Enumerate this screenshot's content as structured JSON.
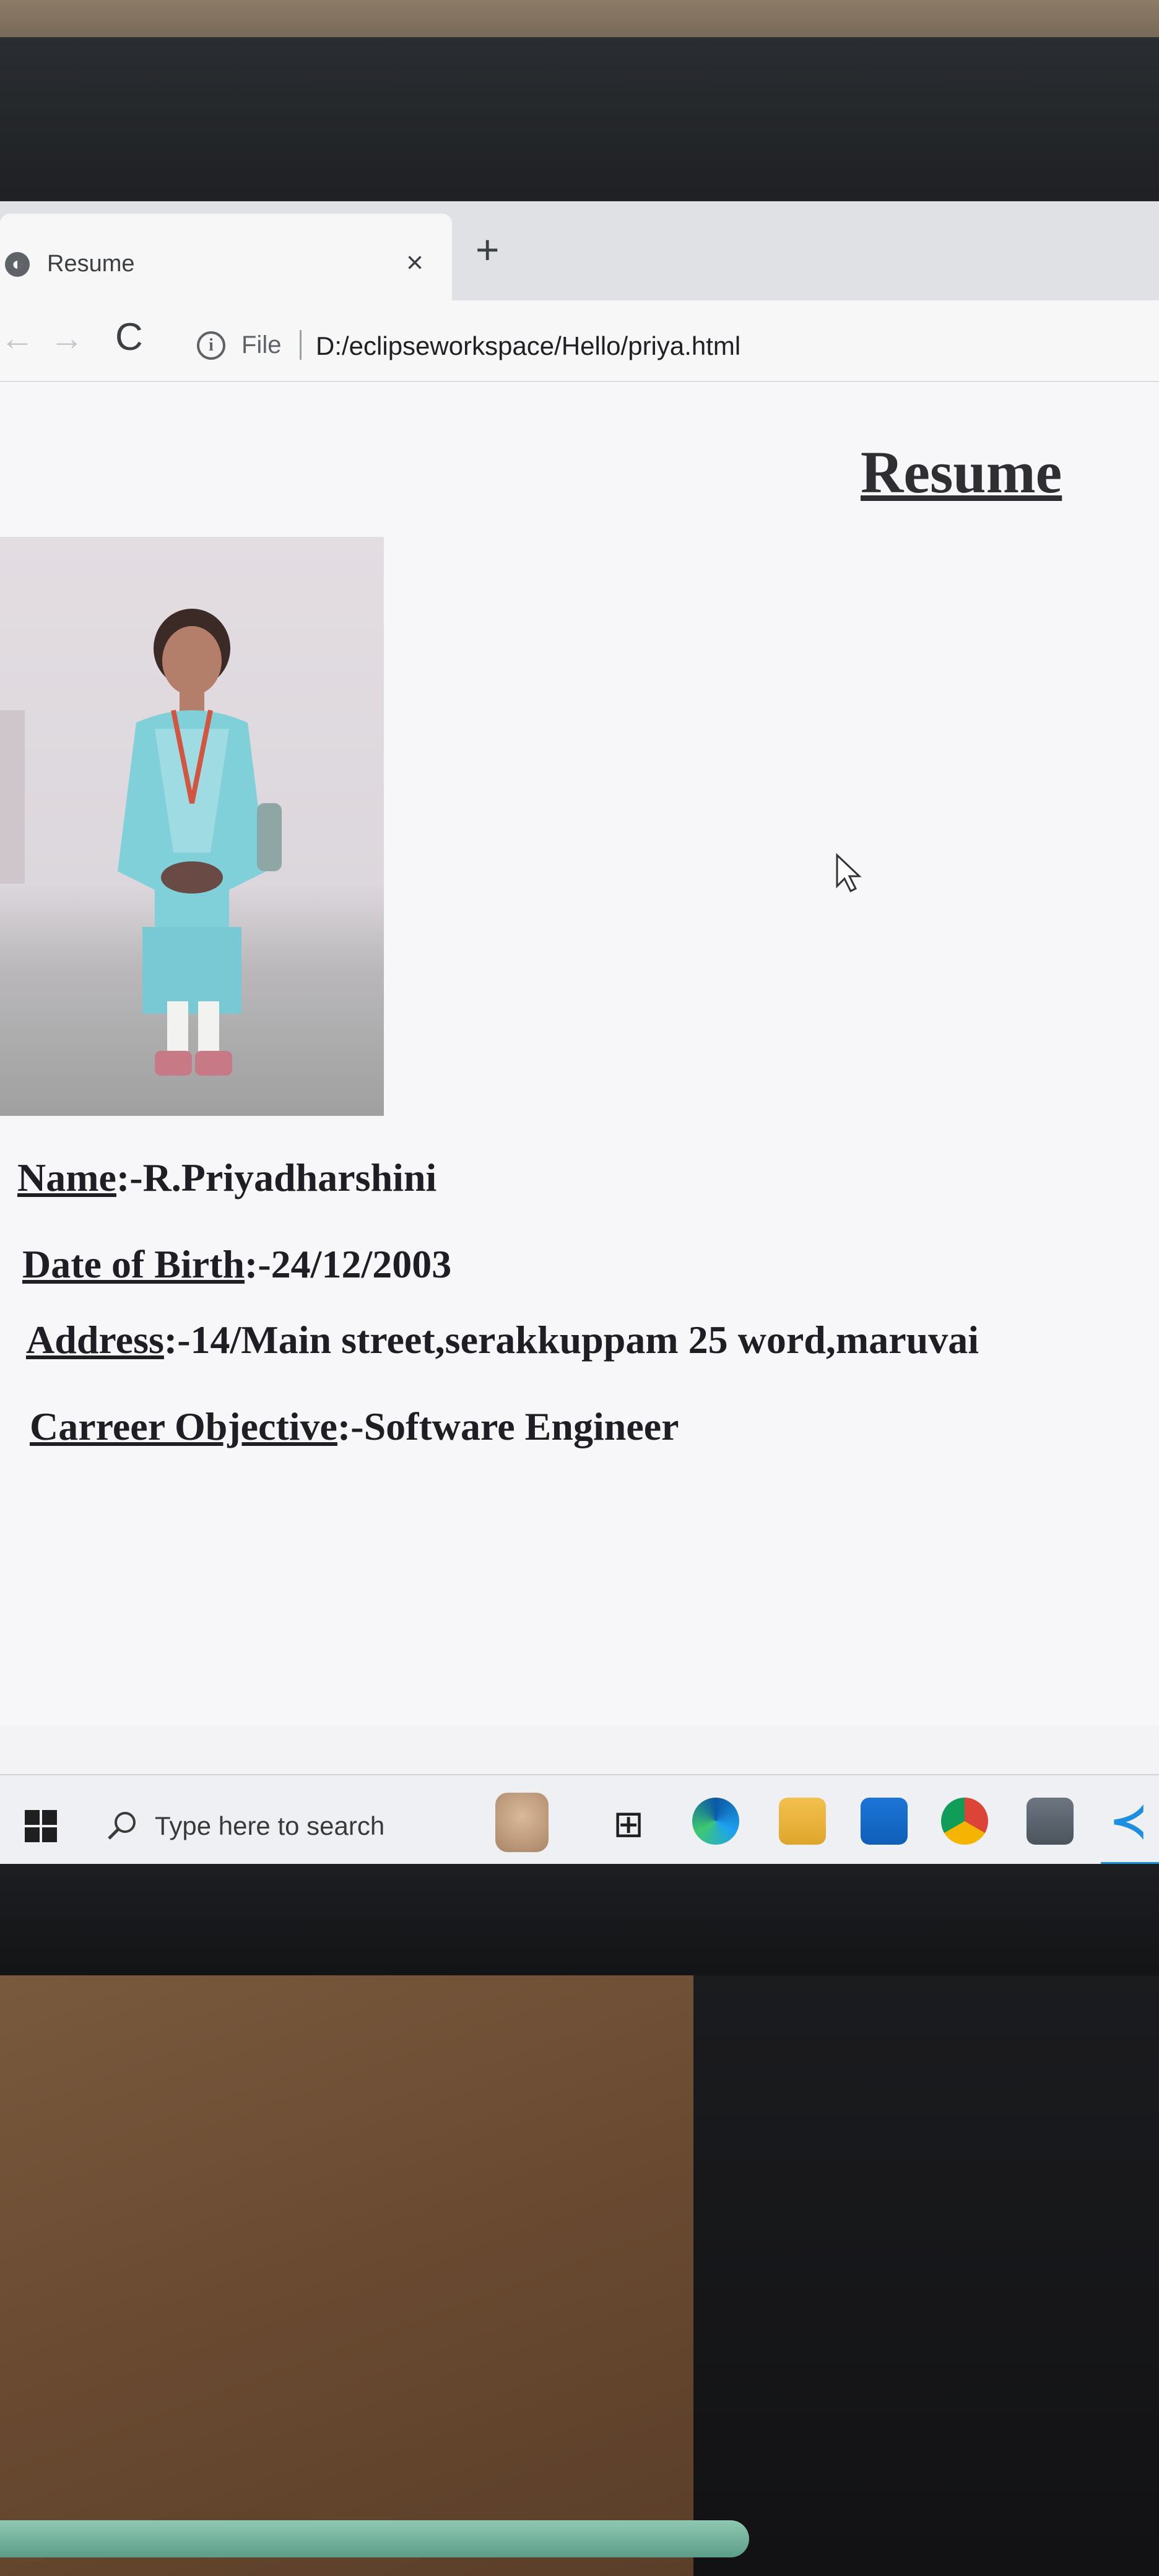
{
  "browser": {
    "tab_title": "Resume",
    "tab_close_glyph": "×",
    "new_tab_glyph": "+",
    "back_glyph": "←",
    "forward_glyph": "→",
    "reload_glyph": "C",
    "info_glyph": "i",
    "address_scheme_label": "File",
    "url": "D:/eclipseworkspace/Hello/priya.html"
  },
  "resume": {
    "heading": "Resume",
    "fields": [
      {
        "label": "Name",
        "value": ":-R.Priyadharshini"
      },
      {
        "label": "Date of Birth",
        "value": ":-24/12/2003"
      },
      {
        "label": "Address",
        "value": ":-14/Main street,serakkuppam 25 word,maruvai"
      },
      {
        "label": "Carreer Objective",
        "value": ":-Software Engineer"
      }
    ]
  },
  "taskbar": {
    "search_placeholder": "Type here to search",
    "taskview_glyph": "⊞",
    "vscode_glyph": "≺",
    "pinned_apps": [
      "edge-icon",
      "file-explorer-icon",
      "mail-icon",
      "chrome-icon",
      "calculator-icon",
      "vscode-icon"
    ]
  },
  "colors": {
    "heading_text": "#2e2e33",
    "body_text": "#1f1e24",
    "taskbar_bg": "#eef0f3",
    "dress_teal": "#7fd0d9"
  }
}
